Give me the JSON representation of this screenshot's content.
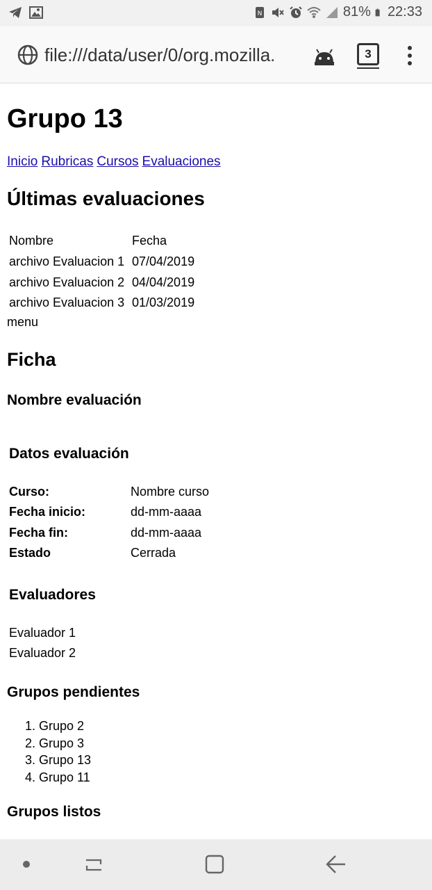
{
  "status_bar": {
    "battery": "81%",
    "time": "22:33",
    "left_icons": [
      "telegram-icon",
      "image-icon"
    ],
    "right_icons": [
      "nfc-icon",
      "mute-icon",
      "alarm-icon",
      "wifi-icon",
      "signal-icon",
      "battery-icon"
    ]
  },
  "browser": {
    "url": "file:///data/user/0/org.mozilla.",
    "tab_count": "3"
  },
  "page": {
    "title": "Grupo 13",
    "nav_links": [
      "Inicio",
      "Rubricas",
      "Cursos",
      "Evaluaciones"
    ],
    "latest_heading": "Últimas evaluaciones",
    "latest_table": {
      "headers": [
        "Nombre",
        "Fecha"
      ],
      "rows": [
        [
          "archivo Evaluacion 1",
          "07/04/2019"
        ],
        [
          "archivo Evaluacion 2",
          "04/04/2019"
        ],
        [
          "archivo Evaluacion 3",
          "01/03/2019"
        ]
      ]
    },
    "menu_label": "menu",
    "ficha_heading": "Ficha",
    "nombre_evaluacion": "Nombre evaluación",
    "datos_heading": "Datos evaluación",
    "datos": [
      {
        "label": "Curso:",
        "value": "Nombre curso"
      },
      {
        "label": "Fecha inicio:",
        "value": "dd-mm-aaaa"
      },
      {
        "label": "Fecha fin:",
        "value": "dd-mm-aaaa"
      },
      {
        "label": "Estado",
        "value": "Cerrada"
      }
    ],
    "evaluadores_heading": "Evaluadores",
    "evaluadores": [
      "Evaluador 1",
      "Evaluador 2"
    ],
    "pendientes_heading": "Grupos pendientes",
    "pendientes": [
      "1. Grupo 2",
      "2. Grupo 3",
      "3. Grupo 13",
      "4. Grupo 11"
    ],
    "listos_heading": "Grupos listos"
  }
}
